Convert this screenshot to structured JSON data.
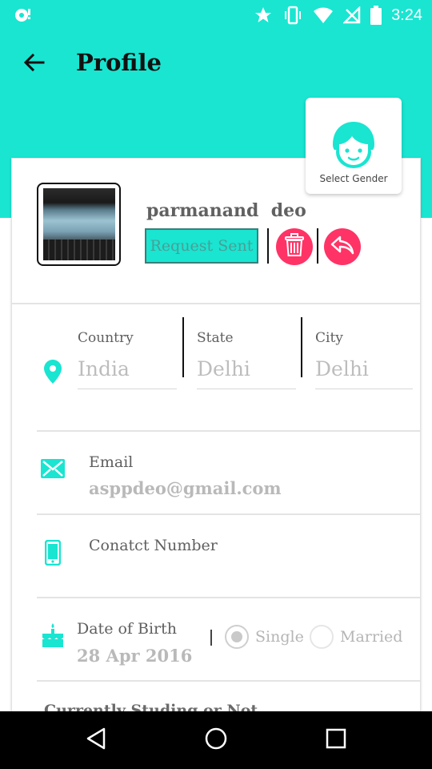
{
  "status_bar": {
    "time": "3:24",
    "icons": [
      "notification-icon",
      "star-icon",
      "vibrate-icon",
      "wifi-icon",
      "no-signal-icon",
      "battery-icon"
    ]
  },
  "app_bar": {
    "title": "Profile",
    "back_icon": "arrow-left-icon"
  },
  "gender_selector": {
    "label": "Select Gender",
    "icon": "boy-face-icon"
  },
  "profile": {
    "name": "parmanand  deo",
    "request_button": "Request Sent",
    "delete_icon": "trash-icon",
    "reply_icon": "reply-icon"
  },
  "location": {
    "country": {
      "label": "Country",
      "placeholder": "India"
    },
    "state": {
      "label": "State",
      "placeholder": "Delhi"
    },
    "city": {
      "label": "City",
      "placeholder": "Delhi"
    }
  },
  "email": {
    "label": "Email",
    "value": "asppdeo@gmail.com"
  },
  "contact": {
    "label": "Conatct Number"
  },
  "dob": {
    "label": "Date of Birth",
    "value": "28 Apr 2016"
  },
  "marital_status": {
    "separator": "|",
    "options": [
      {
        "label": "Single",
        "selected": true
      },
      {
        "label": "Married",
        "selected": false
      }
    ]
  },
  "next_section": {
    "label": "Currently Studing or Not"
  },
  "colors": {
    "accent": "#19e5d1",
    "danger": "#ff3366",
    "navigation_bar": "#000000"
  },
  "nav_bar": {
    "icons": [
      "back-triangle-icon",
      "home-circle-icon",
      "recents-square-icon"
    ]
  }
}
